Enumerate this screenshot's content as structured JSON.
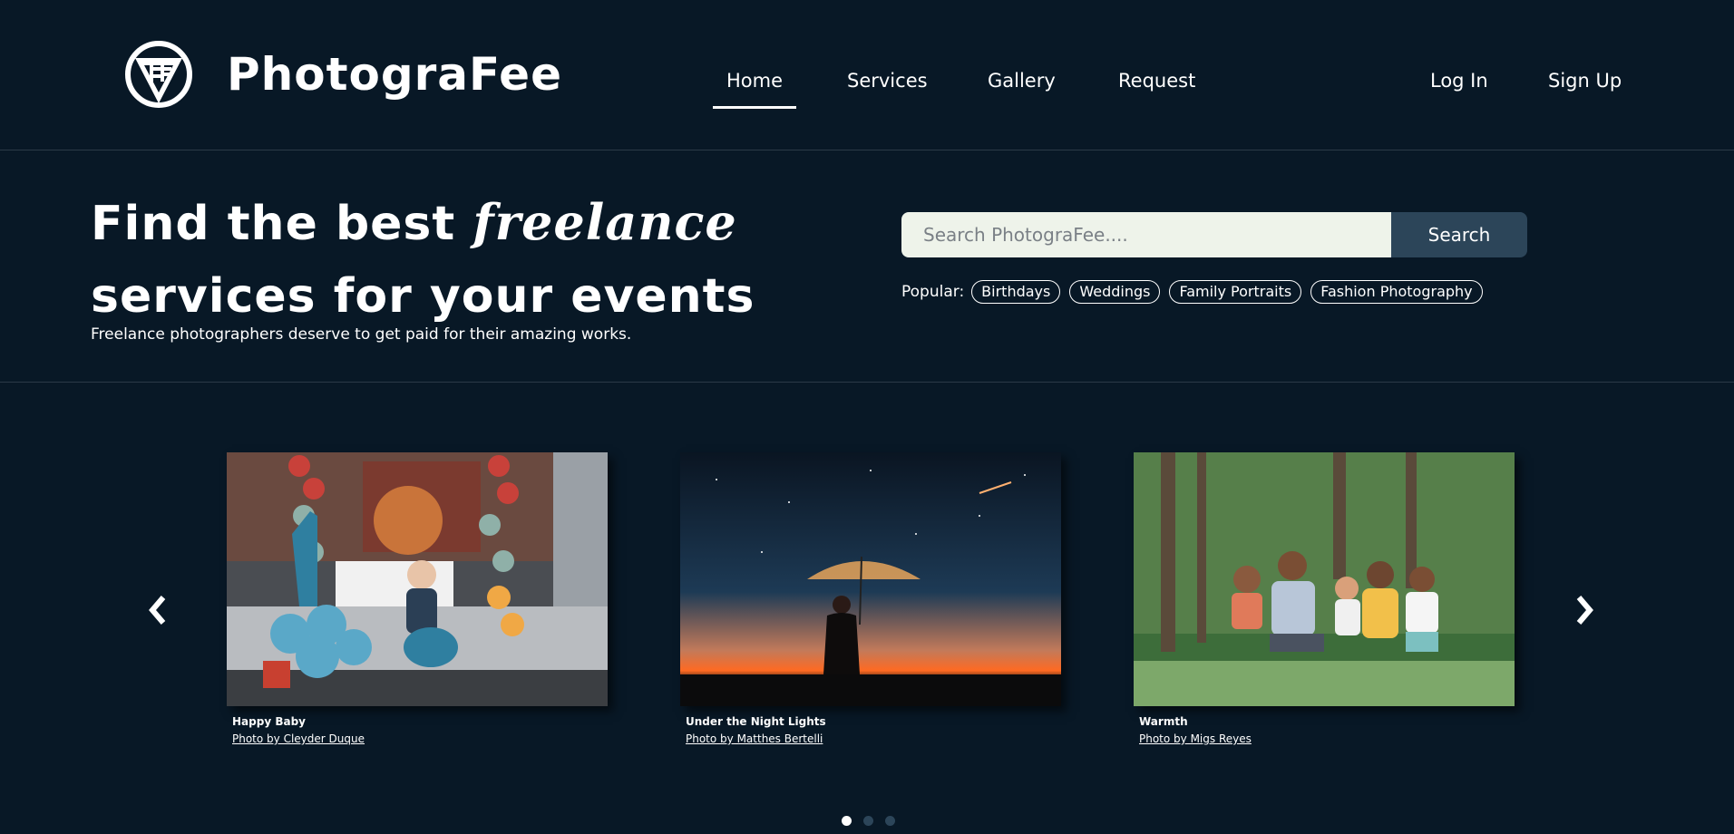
{
  "brand": {
    "name": "PhotograFee",
    "logo_icon": "pf-triangle-logo-icon"
  },
  "nav": {
    "items": [
      {
        "label": "Home",
        "active": true
      },
      {
        "label": "Services",
        "active": false
      },
      {
        "label": "Gallery",
        "active": false
      },
      {
        "label": "Request",
        "active": false
      }
    ],
    "login_label": "Log In",
    "signup_label": "Sign Up"
  },
  "hero": {
    "headline_start": "Find the best ",
    "headline_emphasis": "freelance",
    "headline_end": "services for your events",
    "subline": "Freelance photographers deserve to get paid for their amazing works."
  },
  "search": {
    "placeholder": "Search PhotograFee....",
    "button_label": "Search",
    "popular_label": "Popular:",
    "popular_tags": [
      "Birthdays",
      "Weddings",
      "Family Portraits",
      "Fashion Photography"
    ]
  },
  "carousel": {
    "prev_icon": "chevron-left-icon",
    "next_icon": "chevron-right-icon",
    "cards": [
      {
        "title": "Happy Baby",
        "credit": "Photo by Cleyder Duque"
      },
      {
        "title": "Under the Night Lights",
        "credit": "Photo by Matthes Bertelli"
      },
      {
        "title": "Warmth",
        "credit": "Photo by Migs Reyes"
      }
    ],
    "page_count": 3,
    "active_page": 1
  },
  "colors": {
    "background": "#081826",
    "search_button": "#2c4559",
    "search_field": "#eef3ea",
    "divider": "#2b3a47"
  }
}
